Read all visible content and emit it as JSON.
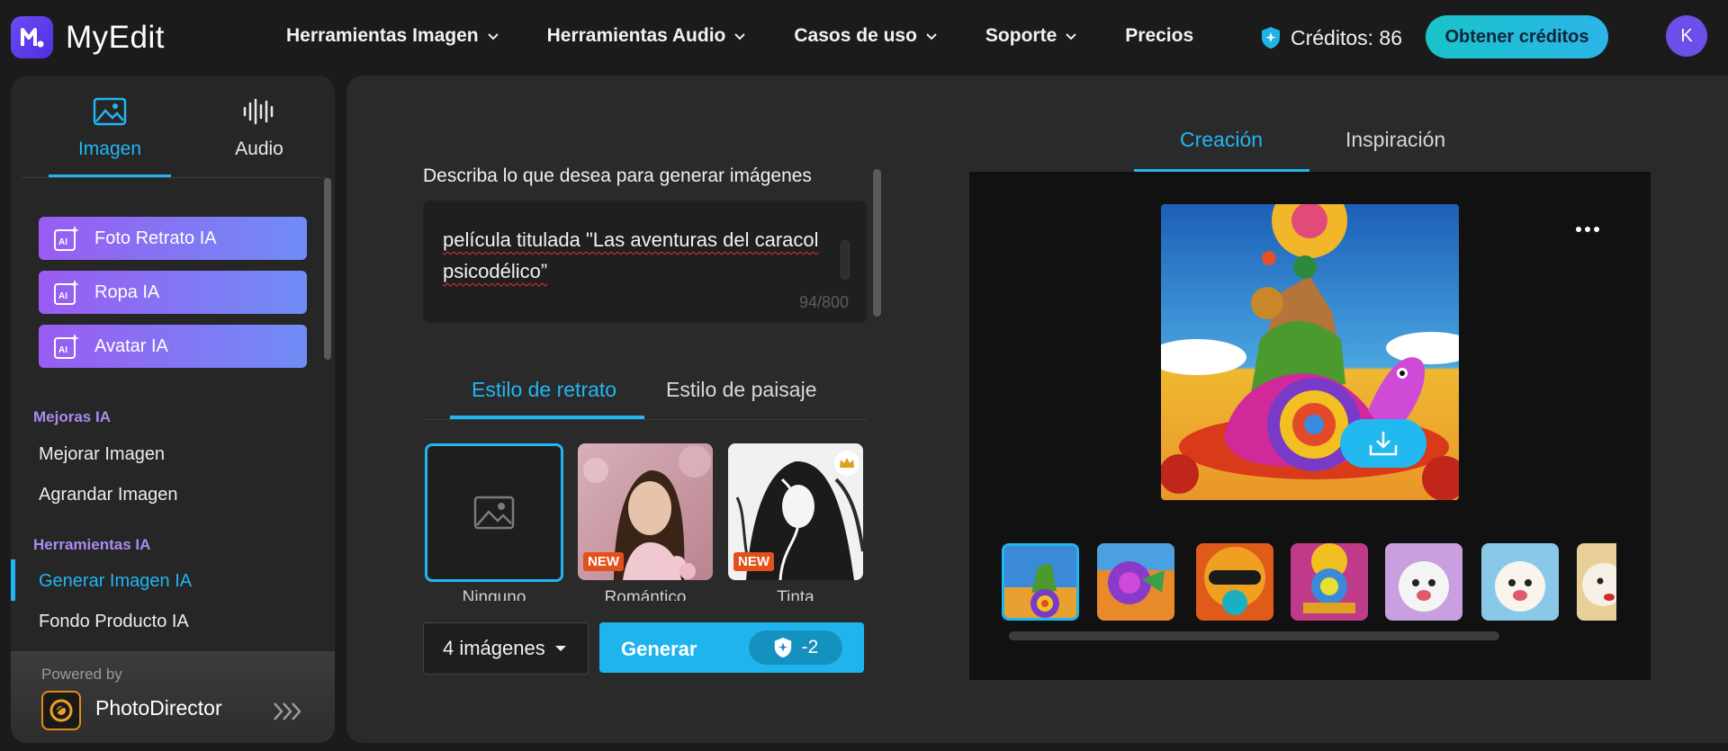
{
  "app": {
    "name": "MyEdit",
    "logo_letter": "M"
  },
  "nav": {
    "items": [
      {
        "label": "Herramientas Imagen",
        "has_dropdown": true
      },
      {
        "label": "Herramientas Audio",
        "has_dropdown": true
      },
      {
        "label": "Casos de uso",
        "has_dropdown": true
      },
      {
        "label": "Soporte",
        "has_dropdown": true
      },
      {
        "label": "Precios",
        "has_dropdown": false
      }
    ],
    "credits_label": "Créditos: 86",
    "get_credits_label": "Obtener créditos",
    "avatar_initial": "K"
  },
  "sidebar": {
    "tabs": [
      {
        "label": "Imagen",
        "icon": "image-icon",
        "active": true
      },
      {
        "label": "Audio",
        "icon": "waveform-icon",
        "active": false
      }
    ],
    "ai_buttons": [
      {
        "label": "Foto Retrato IA"
      },
      {
        "label": "Ropa IA"
      },
      {
        "label": "Avatar IA"
      }
    ],
    "sections": [
      {
        "title": "Mejoras IA",
        "items": [
          "Mejorar Imagen",
          "Agrandar Imagen"
        ]
      },
      {
        "title": "Herramientas IA",
        "items": [
          "Generar Imagen IA",
          "Fondo Producto IA"
        ]
      }
    ],
    "active_item": "Generar Imagen IA",
    "powered_by_label": "Powered by",
    "powered_by_product": "PhotoDirector"
  },
  "generator": {
    "prompt_label": "Describa lo que desea para generar imágenes",
    "prompt_text": "película titulada \"Las aventuras del caracol psicodélico”",
    "char_count": "94/800",
    "style_tabs": [
      {
        "label": "Estilo de retrato",
        "active": true
      },
      {
        "label": "Estilo de paisaje",
        "active": false
      }
    ],
    "styles": [
      {
        "label": "Ninguno",
        "selected": true,
        "badge": ""
      },
      {
        "label": "Romántico",
        "selected": false,
        "badge": "NEW"
      },
      {
        "label": "Tinta",
        "selected": false,
        "badge": "NEW",
        "premium": true
      }
    ],
    "count_select": "4 imágenes",
    "generate_label": "Generar",
    "generate_cost": "-2"
  },
  "preview": {
    "tabs": [
      {
        "label": "Creación",
        "active": true
      },
      {
        "label": "Inspiración",
        "active": false
      }
    ],
    "thumbnails_count": 7,
    "selected_thumbnail": 1
  },
  "colors": {
    "accent": "#21b6f2",
    "purple": "#9a5cf2",
    "credits_button": "#19c4c9",
    "new_badge": "#e4501a"
  }
}
